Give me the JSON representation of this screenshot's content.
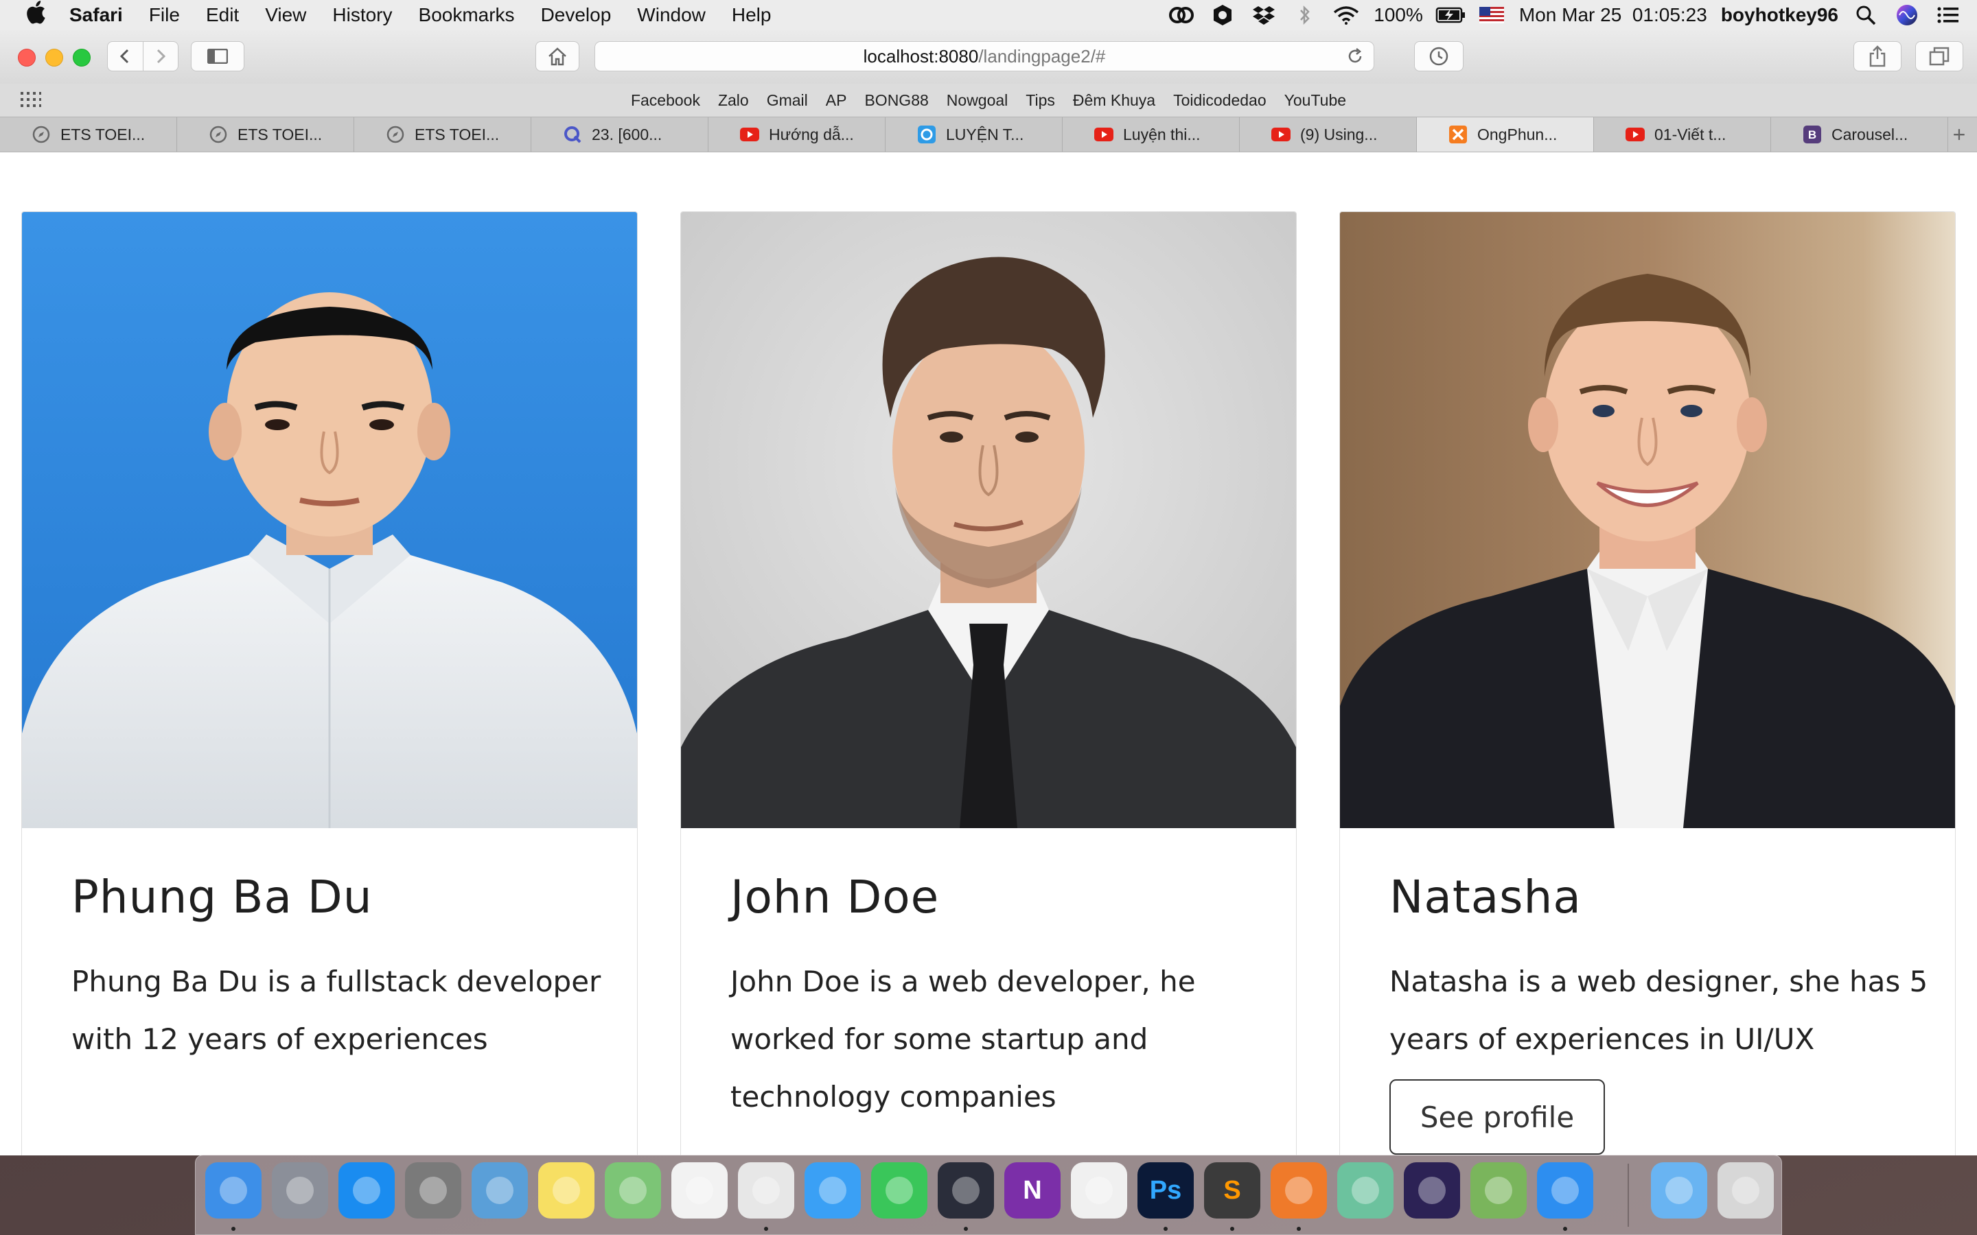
{
  "menubar": {
    "apple_icon": "apple-logo",
    "items": [
      "Safari",
      "File",
      "Edit",
      "View",
      "History",
      "Bookmarks",
      "Develop",
      "Window",
      "Help"
    ],
    "status": {
      "battery": "100%",
      "datetime": "Mon Mar 25  01:05:23",
      "user": "boyhotkey96"
    }
  },
  "browser": {
    "address": {
      "host": "localhost:8080",
      "path": "/landingpage2/#"
    },
    "favorites": [
      "Facebook",
      "Zalo",
      "Gmail",
      "AP",
      "BONG88",
      "Nowgoal",
      "Tips",
      "Đêm Khuya",
      "Toidicodedao",
      "YouTube"
    ],
    "tabs": [
      {
        "title": "ETS TOEI...",
        "icon": "compass-icon",
        "color": "#666666"
      },
      {
        "title": "ETS TOEI...",
        "icon": "compass-icon",
        "color": "#666666"
      },
      {
        "title": "ETS TOEI...",
        "icon": "compass-icon",
        "color": "#666666"
      },
      {
        "title": "23. [600...",
        "icon": "q-icon",
        "color": "#4a56c8"
      },
      {
        "title": "Hướng dẫ...",
        "icon": "youtube-icon",
        "color": "#e62117"
      },
      {
        "title": "LUYỆN T...",
        "icon": "refresh-site-icon",
        "color": "#2e9be6"
      },
      {
        "title": "Luyện thi...",
        "icon": "youtube-icon",
        "color": "#e62117"
      },
      {
        "title": "(9) Using...",
        "icon": "youtube-icon",
        "color": "#e62117"
      },
      {
        "title": "OngPhun...",
        "icon": "xampp-icon",
        "color": "#f57c20"
      },
      {
        "title": "01-Viết t...",
        "icon": "youtube-icon",
        "color": "#e62117"
      },
      {
        "title": "Carousel...",
        "icon": "bootstrap-icon",
        "color": "#563d7c"
      }
    ],
    "active_tab": 8
  },
  "cards": [
    {
      "name": "Phung Ba Du",
      "description": "Phung Ba Du is a fullstack developer with 12 years of experiences",
      "photo": "profile-photo-blue-background"
    },
    {
      "name": "John Doe",
      "description": "John Doe is a web developer, he worked for some startup and technology companies",
      "photo": "profile-photo-grey-background"
    },
    {
      "name": "Natasha",
      "description": "Natasha is a web designer, she has 5 years of experiences in UI/UX",
      "photo": "profile-photo-wood-background",
      "button": "See profile"
    }
  ],
  "dock": {
    "apps": [
      {
        "name": "finder-icon",
        "color": "#3d8fe8",
        "running": true
      },
      {
        "name": "launchpad-icon",
        "color": "#8b8f99",
        "running": false
      },
      {
        "name": "app-store-icon",
        "color": "#1a8cf0",
        "running": false
      },
      {
        "name": "system-preferences-icon",
        "color": "#7a7a7a",
        "running": false
      },
      {
        "name": "mail-icon",
        "color": "#5a9fd8",
        "running": false
      },
      {
        "name": "notes-icon",
        "color": "#f7df63",
        "running": false
      },
      {
        "name": "maps-icon",
        "color": "#7cc576",
        "running": false
      },
      {
        "name": "photos-icon",
        "color": "#f2f2f2",
        "running": false
      },
      {
        "name": "chrome-icon",
        "color": "#e7e7e7",
        "running": true
      },
      {
        "name": "messages-icon",
        "color": "#3aa0f5",
        "running": false
      },
      {
        "name": "facetime-icon",
        "color": "#3ac65a",
        "running": false
      },
      {
        "name": "camera-app-icon",
        "color": "#2a2d3a",
        "running": true
      },
      {
        "name": "onenote-icon",
        "color": "#7b2fa8",
        "running": false
      },
      {
        "name": "textedit-icon",
        "color": "#f0f0f0",
        "running": false
      },
      {
        "name": "photoshop-icon",
        "color": "#0b1a38",
        "running": true
      },
      {
        "name": "sublime-text-icon",
        "color": "#3b3b3b",
        "running": true
      },
      {
        "name": "xampp-icon",
        "color": "#ef7a2a",
        "running": true
      },
      {
        "name": "atom-icon",
        "color": "#6cc29e",
        "running": false
      },
      {
        "name": "eclipse-icon",
        "color": "#2c2255",
        "running": false
      },
      {
        "name": "android-studio-icon",
        "color": "#7ab55c",
        "running": false
      },
      {
        "name": "safari-icon",
        "color": "#2d8ef0",
        "running": true
      },
      {
        "name": "downloads-folder-icon",
        "color": "#69b4f2",
        "running": false
      },
      {
        "name": "trash-icon",
        "color": "#d7d7d7",
        "running": false
      }
    ],
    "labels": {
      "photoshop": "Ps",
      "onenote": "N",
      "sublime": "S"
    }
  }
}
